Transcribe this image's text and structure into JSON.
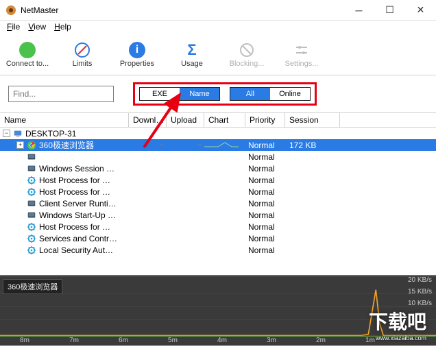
{
  "window": {
    "title": "NetMaster"
  },
  "menu": {
    "file": "File",
    "view": "View",
    "help": "Help"
  },
  "toolbar": {
    "connect": "Connect to...",
    "limits": "Limits",
    "properties": "Properties",
    "usage": "Usage",
    "blocking": "Blocking...",
    "settings": "Settings..."
  },
  "find": {
    "placeholder": "Find..."
  },
  "toggles": {
    "exe": "EXE",
    "name": "Name",
    "all": "All",
    "online": "Online"
  },
  "columns": {
    "name": "Name",
    "download": "Downl…",
    "upload": "Upload",
    "chart": "Chart",
    "priority": "Priority",
    "session": "Session"
  },
  "root": "DESKTOP-31",
  "rows": [
    {
      "name": "360极速浏览器",
      "dl": "--",
      "ul": "--",
      "pri": "Normal",
      "sess": "172 KB",
      "sel": true,
      "icon": "chrome",
      "exp": "+"
    },
    {
      "name": "",
      "dl": "",
      "ul": "",
      "pri": "Normal",
      "sess": "",
      "icon": "win"
    },
    {
      "name": "Windows Session …",
      "dl": "",
      "ul": "",
      "pri": "Normal",
      "sess": "",
      "icon": "win"
    },
    {
      "name": "Host Process for …",
      "dl": "",
      "ul": "",
      "pri": "Normal",
      "sess": "",
      "icon": "gear"
    },
    {
      "name": "Host Process for …",
      "dl": "",
      "ul": "",
      "pri": "Normal",
      "sess": "",
      "icon": "gear"
    },
    {
      "name": "Client Server Runti…",
      "dl": "",
      "ul": "",
      "pri": "Normal",
      "sess": "",
      "icon": "win"
    },
    {
      "name": "Windows Start-Up …",
      "dl": "",
      "ul": "",
      "pri": "Normal",
      "sess": "",
      "icon": "win"
    },
    {
      "name": "Host Process for …",
      "dl": "",
      "ul": "",
      "pri": "Normal",
      "sess": "",
      "icon": "gear"
    },
    {
      "name": "Services and Contr…",
      "dl": "",
      "ul": "",
      "pri": "Normal",
      "sess": "",
      "icon": "gear"
    },
    {
      "name": "Local Security Aut…",
      "dl": "",
      "ul": "",
      "pri": "Normal",
      "sess": "",
      "icon": "gear"
    }
  ],
  "chart": {
    "label": "360极速浏览器",
    "y": [
      "20 KB/s",
      "15 KB/s",
      "10 KB/s"
    ],
    "x": [
      "8m",
      "7m",
      "6m",
      "5m",
      "4m",
      "3m",
      "2m",
      "1m"
    ]
  },
  "watermark": {
    "main": "下载吧",
    "sub": "www.xiazaiba.com"
  }
}
